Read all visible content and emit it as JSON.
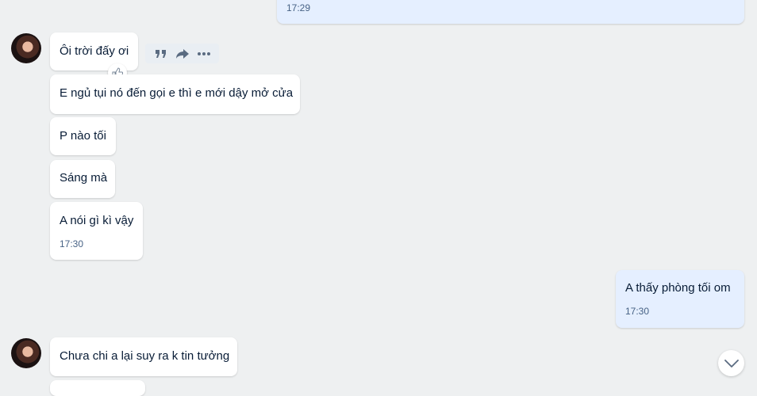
{
  "messages": [
    {
      "text": "",
      "time": "17:29"
    },
    {
      "text": "Ôi trời đấy ơi"
    },
    {
      "text": "E ngủ tụi nó đến gọi e thì e mới dậy mở cửa"
    },
    {
      "text": "P nào tối"
    },
    {
      "text": "Sáng mà"
    },
    {
      "text": "A nói gì kì vậy",
      "time": "17:30"
    },
    {
      "text": "A thấy phòng tối om",
      "time": "17:30"
    },
    {
      "text": "Chưa chi a lại suy ra k tin tưởng"
    }
  ],
  "icons": {
    "quote": "quote-icon",
    "forward": "forward-icon",
    "more": "more-icon",
    "like": "thumbs-up-icon",
    "scroll": "chevron-down-icon"
  },
  "colors": {
    "background": "#eef0f1",
    "incoming_bubble": "#ffffff",
    "outgoing_bubble": "#e5efff",
    "time_text": "#476285"
  }
}
